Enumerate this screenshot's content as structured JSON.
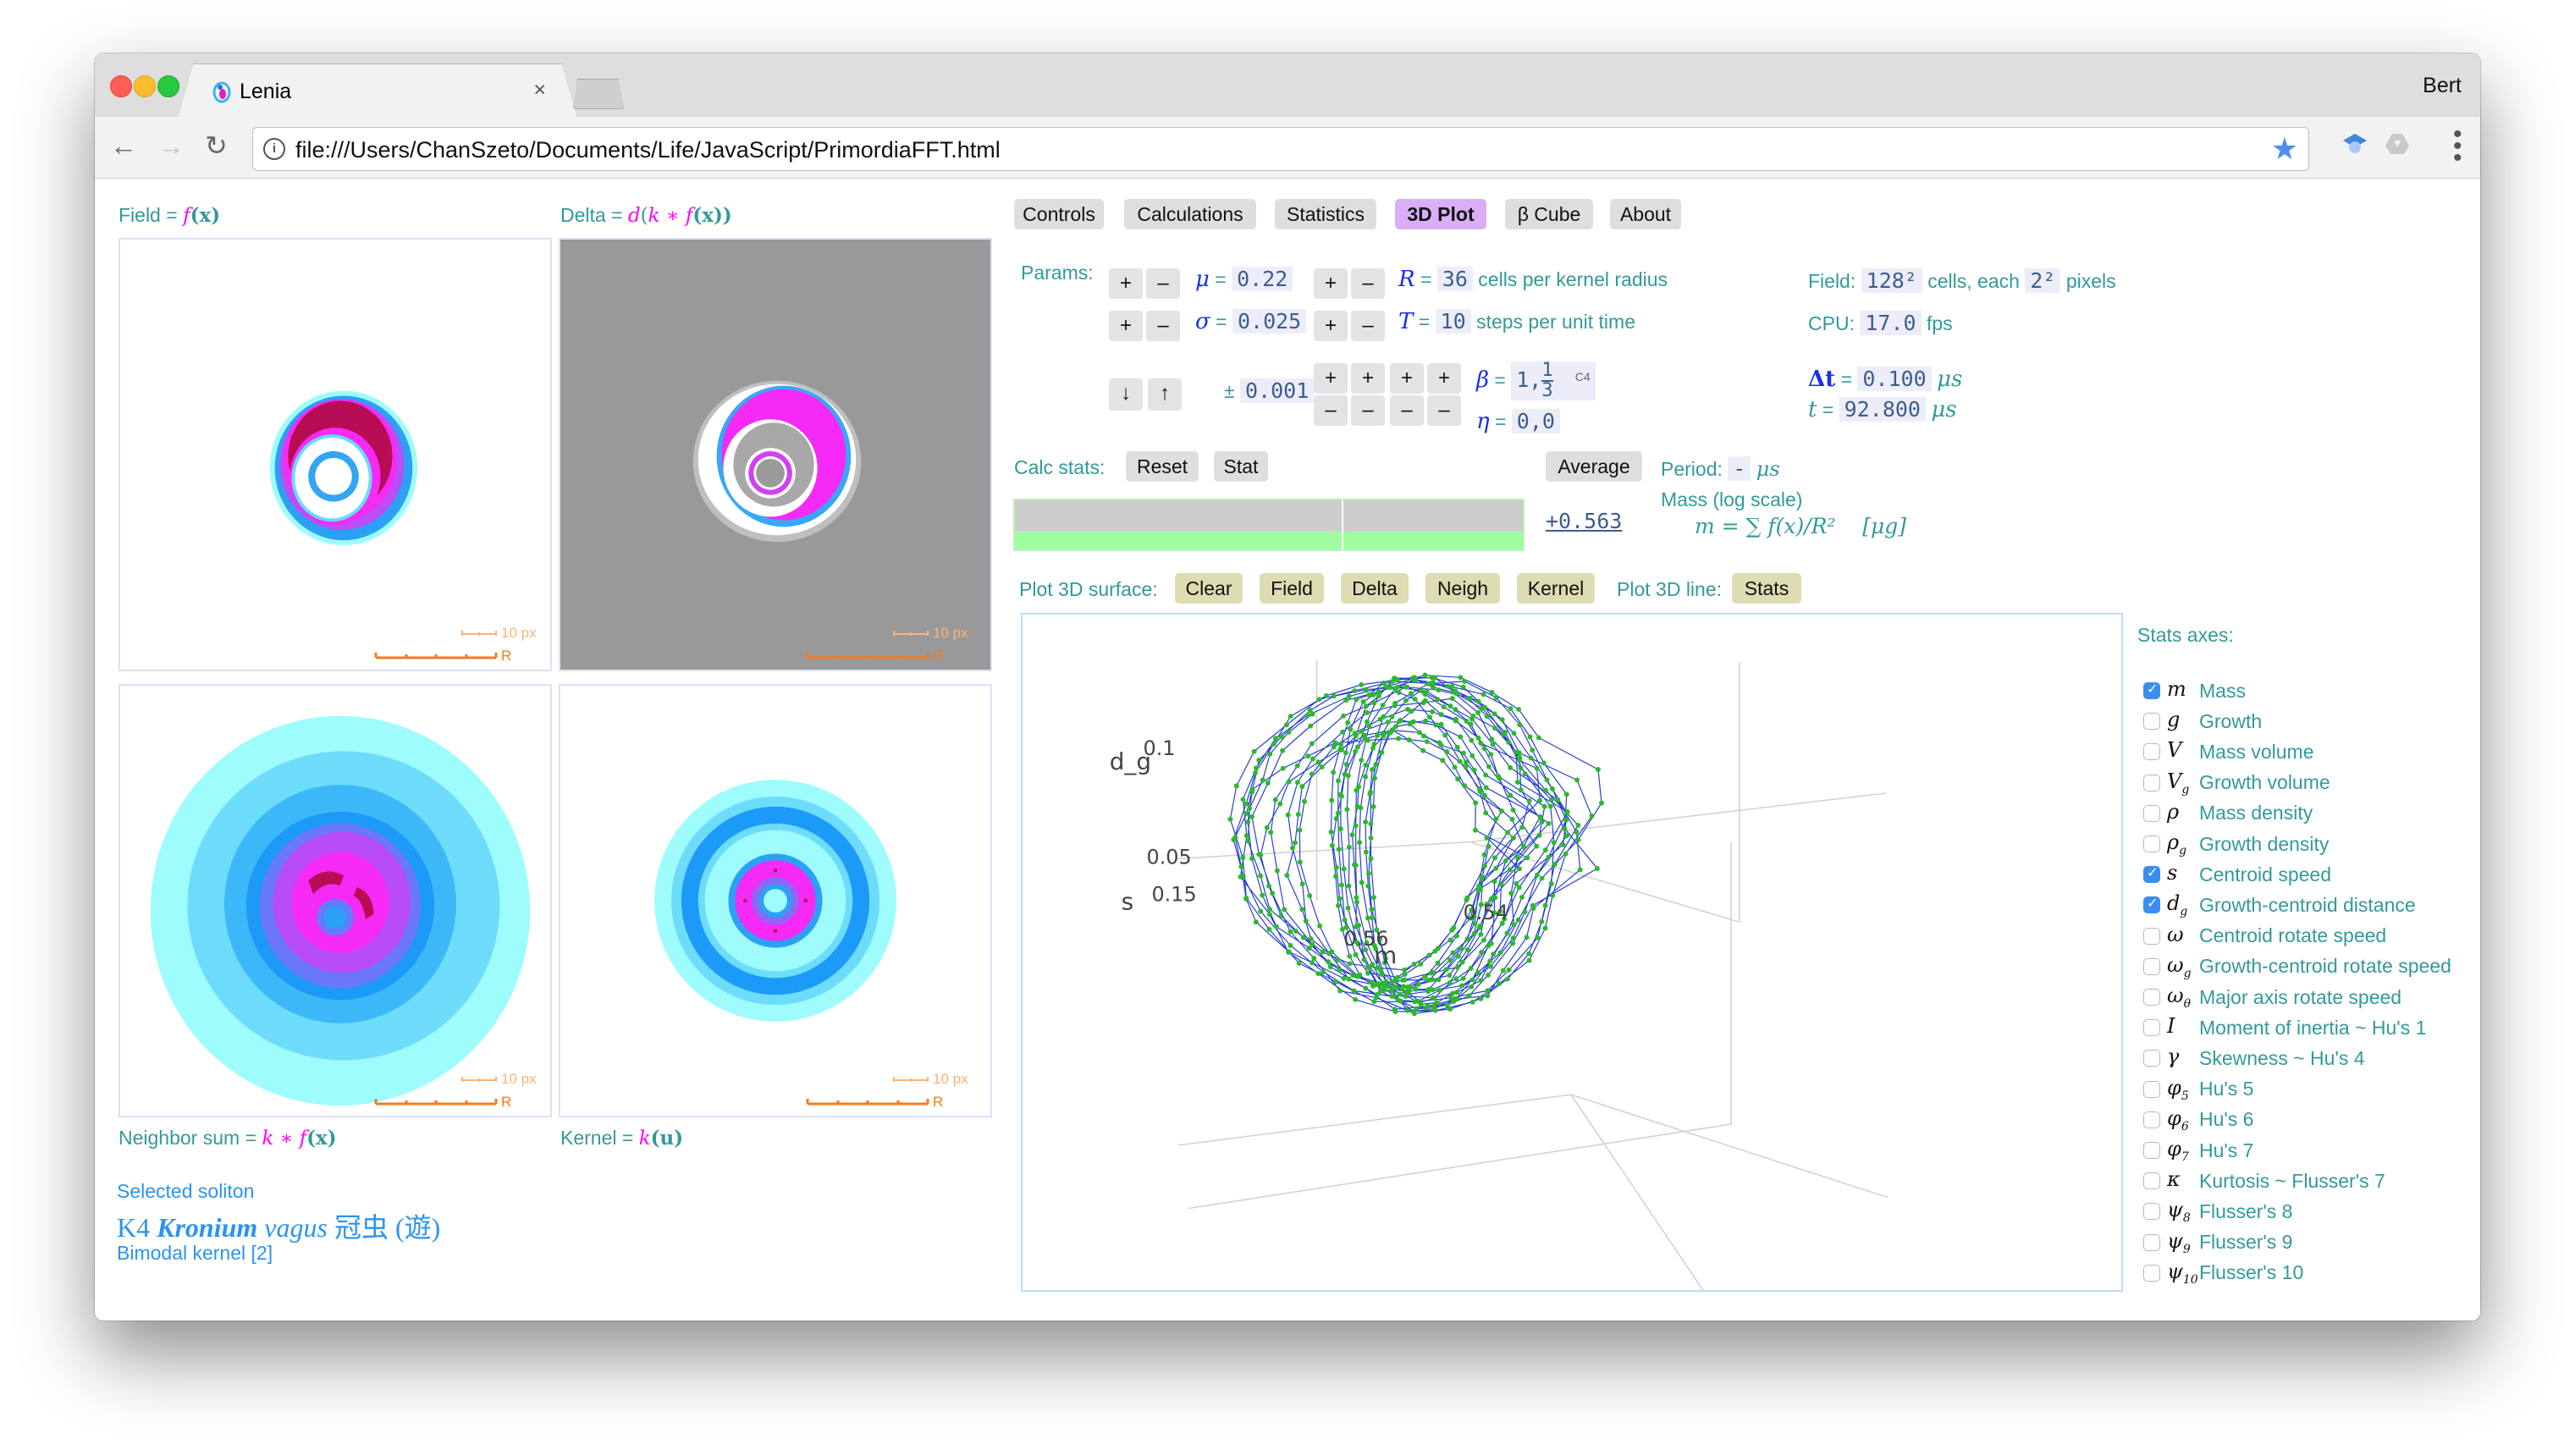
{
  "browser": {
    "tab_title": "Lenia",
    "tab_close": "×",
    "profile_name": "Bert",
    "url": "file:///Users/ChanSzeto/Documents/Life/JavaScript/PrimordiaFFT.html",
    "icons": {
      "back": "←",
      "forward": "→",
      "reload": "↻",
      "info": "i",
      "star": "★",
      "menu": "⋮"
    }
  },
  "panels": {
    "field": {
      "label": "Field = ",
      "formula_f": "f",
      "formula_x": "(x)"
    },
    "delta": {
      "label": "Delta = ",
      "formula_d": "d",
      "formula_open": "(",
      "formula_k": "k ∗ ",
      "formula_f": "f",
      "formula_x": "(x))"
    },
    "neighbor": {
      "label": "Neighbor sum = ",
      "formula_k": "k ∗ ",
      "formula_f": "f",
      "formula_x": "(x)"
    },
    "kernel": {
      "label": "Kernel = ",
      "formula_k": "k",
      "formula_u": "(u)"
    },
    "scale_px": "10 px",
    "scale_r": "R"
  },
  "soliton": {
    "heading": "Selected soliton",
    "code": "K4",
    "genus": "Kronium",
    "species": "vagus",
    "chinese": "冠虫 (遊)",
    "kernel_type": "Bimodal kernel [2]"
  },
  "tabs": [
    {
      "label": "Controls",
      "active": false
    },
    {
      "label": "Calculations",
      "active": false
    },
    {
      "label": "Statistics",
      "active": false
    },
    {
      "label": "3D Plot",
      "active": true
    },
    {
      "label": "β Cube",
      "active": false
    },
    {
      "label": "About",
      "active": false
    }
  ],
  "params": {
    "label": "Params:",
    "plus": "+",
    "minus": "–",
    "down": "↓",
    "up": "↑",
    "mu": {
      "symbol": "μ",
      "value": "0.22"
    },
    "sigma": {
      "symbol": "σ",
      "value": "0.025"
    },
    "step": {
      "prefix": "±",
      "value": "0.001"
    },
    "R": {
      "symbol": "R",
      "value": "36",
      "unit": "cells per kernel radius"
    },
    "T": {
      "symbol": "T",
      "value": "10",
      "unit": "steps per unit time"
    },
    "beta": {
      "symbol": "β",
      "value_int": "1,",
      "frac_num": "1",
      "frac_den": "3",
      "tag": "C4"
    },
    "eta": {
      "symbol": "η",
      "value": "0,0"
    },
    "field": {
      "label": "Field:",
      "cells": "128²",
      "mid": "cells, each",
      "pixels": "2²",
      "unit": "pixels"
    },
    "cpu": {
      "label": "CPU:",
      "value": "17.0",
      "unit": "fps"
    },
    "dt": {
      "symbol": "Δt",
      "value": "0.100",
      "unit": "μs"
    },
    "t": {
      "symbol": "t",
      "value": "92.800",
      "unit": "μs"
    }
  },
  "calc_stats": {
    "label": "Calc stats:",
    "reset": "Reset",
    "stat": "Stat",
    "average": "Average",
    "period_label": "Period:",
    "period_value": "-",
    "period_unit": "μs",
    "current_value": "+0.563",
    "mass_label": "Mass (log scale)",
    "mass_formula": "m = ∑ f(x)/R²",
    "mass_unit": "[μg]",
    "bar_fill_fraction": 0.37
  },
  "plot3d": {
    "surface_label": "Plot 3D surface:",
    "surface_buttons": [
      "Clear",
      "Field",
      "Delta",
      "Neigh",
      "Kernel"
    ],
    "line_label": "Plot 3D line:",
    "line_button": "Stats"
  },
  "chart_data": {
    "type": "scatter",
    "title": "",
    "mode": "3d-lines+markers",
    "axes": {
      "x": {
        "label": "m",
        "ticks": [
          "0.54",
          "0.56"
        ]
      },
      "y": {
        "label": "s",
        "ticks": [
          "0.15"
        ]
      },
      "z": {
        "label": "d_g",
        "ticks": [
          "0.05",
          "0.1"
        ]
      }
    },
    "line_color": "#2440d0",
    "marker_color": "#2db82d",
    "description": "Looping trajectory of (m, s, d_g) stats over time"
  },
  "stats_axes": {
    "title": "Stats axes:",
    "items": [
      {
        "symbol": "m",
        "sub": "",
        "label": "Mass",
        "checked": true
      },
      {
        "symbol": "g",
        "sub": "",
        "label": "Growth",
        "checked": false
      },
      {
        "symbol": "V",
        "sub": "",
        "label": "Mass volume",
        "checked": false
      },
      {
        "symbol": "V",
        "sub": "g",
        "label": "Growth volume",
        "checked": false
      },
      {
        "symbol": "ρ",
        "sub": "",
        "label": "Mass density",
        "checked": false
      },
      {
        "symbol": "ρ",
        "sub": "g",
        "label": "Growth density",
        "checked": false
      },
      {
        "symbol": "s",
        "sub": "",
        "label": "Centroid speed",
        "checked": true
      },
      {
        "symbol": "d",
        "sub": "g",
        "label": "Growth-centroid distance",
        "checked": true
      },
      {
        "symbol": "ω",
        "sub": "",
        "label": "Centroid rotate speed",
        "checked": false
      },
      {
        "symbol": "ω",
        "sub": "g",
        "label": "Growth-centroid rotate speed",
        "checked": false
      },
      {
        "symbol": "ω",
        "sub": "θ",
        "label": "Major axis rotate speed",
        "checked": false
      },
      {
        "symbol": "I",
        "sub": "",
        "label": "Moment of inertia ~ Hu's 1",
        "checked": false
      },
      {
        "symbol": "γ",
        "sub": "",
        "label": "Skewness ~ Hu's 4",
        "checked": false
      },
      {
        "symbol": "φ",
        "sub": "5",
        "label": "Hu's 5",
        "checked": false
      },
      {
        "symbol": "φ",
        "sub": "6",
        "label": "Hu's 6",
        "checked": false
      },
      {
        "symbol": "φ",
        "sub": "7",
        "label": "Hu's 7",
        "checked": false
      },
      {
        "symbol": "κ",
        "sub": "",
        "label": "Kurtosis ~ Flusser's 7",
        "checked": false
      },
      {
        "symbol": "ψ",
        "sub": "8",
        "label": "Flusser's 8",
        "checked": false
      },
      {
        "symbol": "ψ",
        "sub": "9",
        "label": "Flusser's 9",
        "checked": false
      },
      {
        "symbol": "ψ",
        "sub": "10",
        "label": "Flusser's 10",
        "checked": false
      }
    ]
  }
}
